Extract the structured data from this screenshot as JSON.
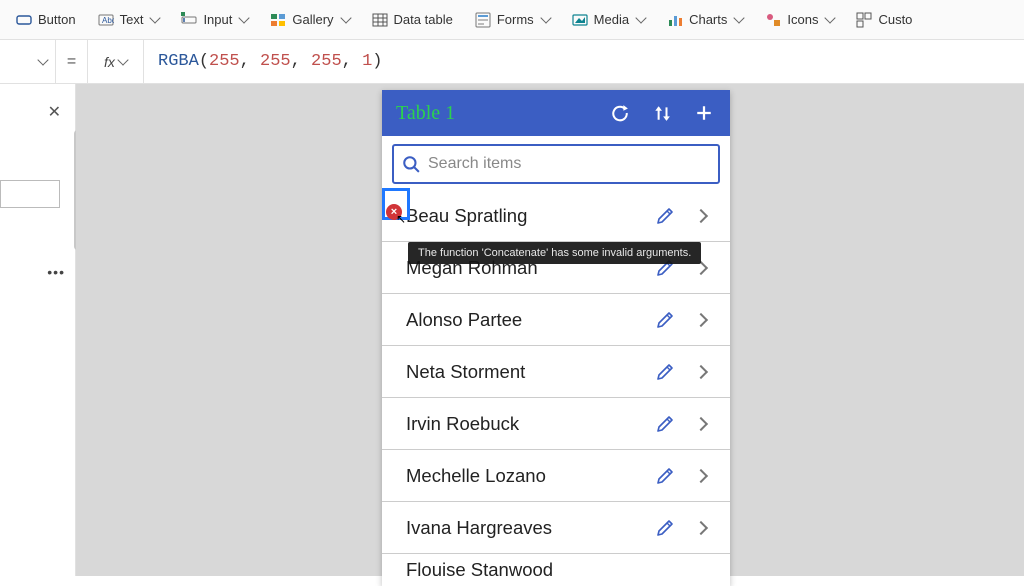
{
  "ribbon": [
    {
      "label": "Button",
      "icon": "button"
    },
    {
      "label": "Text",
      "icon": "text",
      "dd": true
    },
    {
      "label": "Input",
      "icon": "input",
      "dd": true
    },
    {
      "label": "Gallery",
      "icon": "gallery",
      "dd": true
    },
    {
      "label": "Data table",
      "icon": "datatable"
    },
    {
      "label": "Forms",
      "icon": "forms",
      "dd": true
    },
    {
      "label": "Media",
      "icon": "media",
      "dd": true
    },
    {
      "label": "Charts",
      "icon": "charts",
      "dd": true
    },
    {
      "label": "Icons",
      "icon": "icons",
      "dd": true
    },
    {
      "label": "Custo",
      "icon": "custom"
    }
  ],
  "formula": {
    "eq": "=",
    "fx": "fx",
    "fn": "RGBA",
    "open": "(",
    "a1": "255",
    "c": ", ",
    "a2": "255",
    "a3": "255",
    "a4": "1",
    "close": ")"
  },
  "app": {
    "title": "Table 1",
    "search_placeholder": "Search items",
    "items": [
      "Beau Spratling",
      "Megan Rohman",
      "Alonso Partee",
      "Neta Storment",
      "Irvin Roebuck",
      "Mechelle Lozano",
      "Ivana Hargreaves",
      "Flouise Stanwood"
    ],
    "error_tooltip": "The function 'Concatenate' has some invalid arguments.",
    "error_glyph": "×"
  }
}
